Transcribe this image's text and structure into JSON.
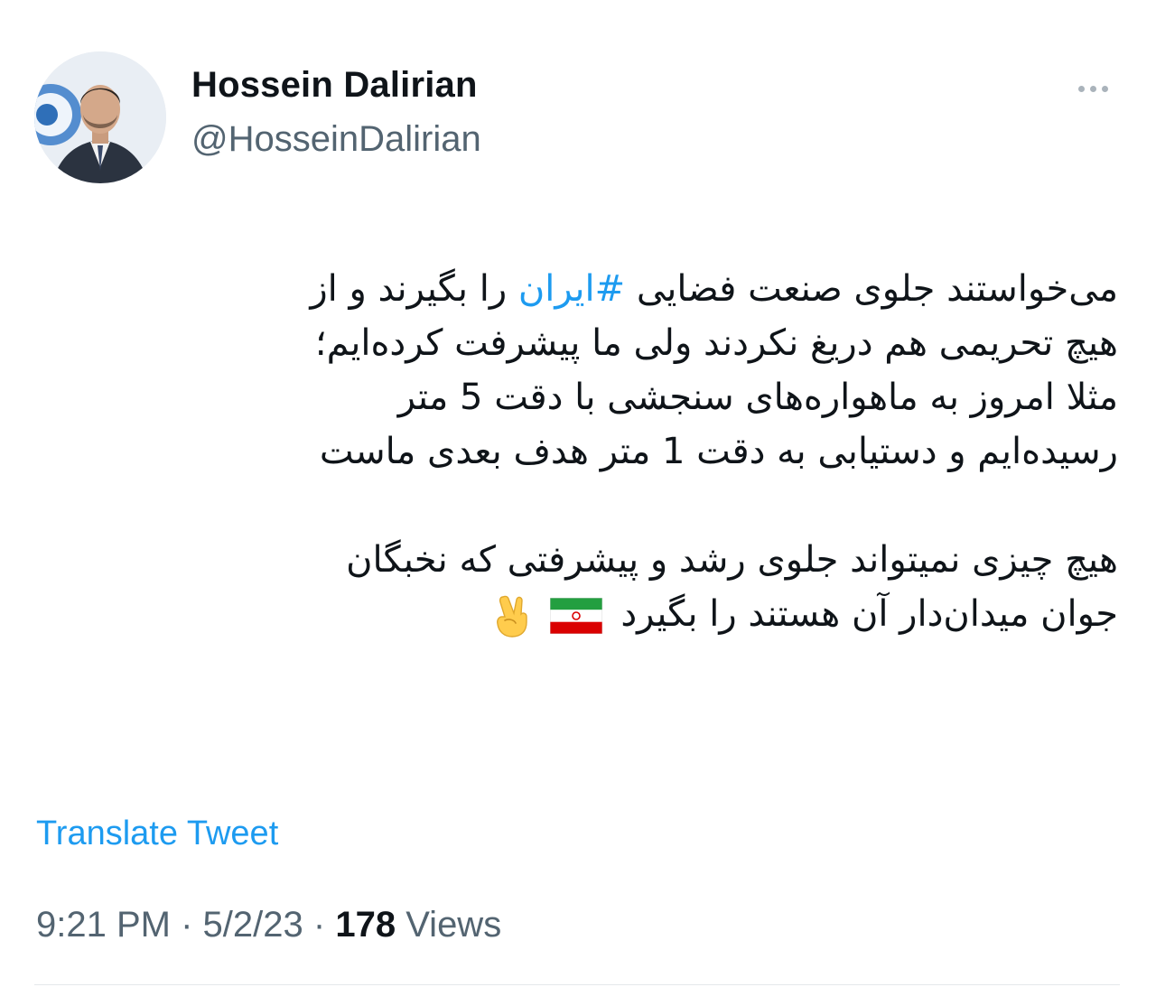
{
  "author": {
    "display_name": "Hossein Dalirian",
    "handle": "@HosseinDalirian"
  },
  "tweet": {
    "line1_start": "می‌خواستند جلوی صنعت فضایی ",
    "hashtag": "#ایران",
    "line1_end": " را بگیرند و از",
    "line2": "هیچ تحریمی هم دریغ نکردند ولی ما پیشرفت کرده‌ایم؛",
    "line3": "مثلا امروز به ماهواره‌های سنجشی با دقت 5 متر",
    "line4": "رسیده‌ایم و دستیابی به دقت 1 متر هدف بعدی ماست",
    "line5": "هیچ چیزی نمیتواند جلوی رشد و پیشرفتی که نخبگان",
    "line6": "جوان میدان‌دار آن هستند را بگیرد",
    "emojis": [
      "iran-flag-icon",
      "victory-hand-icon"
    ]
  },
  "translate_label": "Translate Tweet",
  "meta": {
    "time": "9:21 PM",
    "separator": "·",
    "date": "5/2/23",
    "views_count": "178",
    "views_label": "Views"
  },
  "colors": {
    "link": "#1d9bf0",
    "secondary_text": "#536471",
    "primary_text": "#0f1419"
  }
}
